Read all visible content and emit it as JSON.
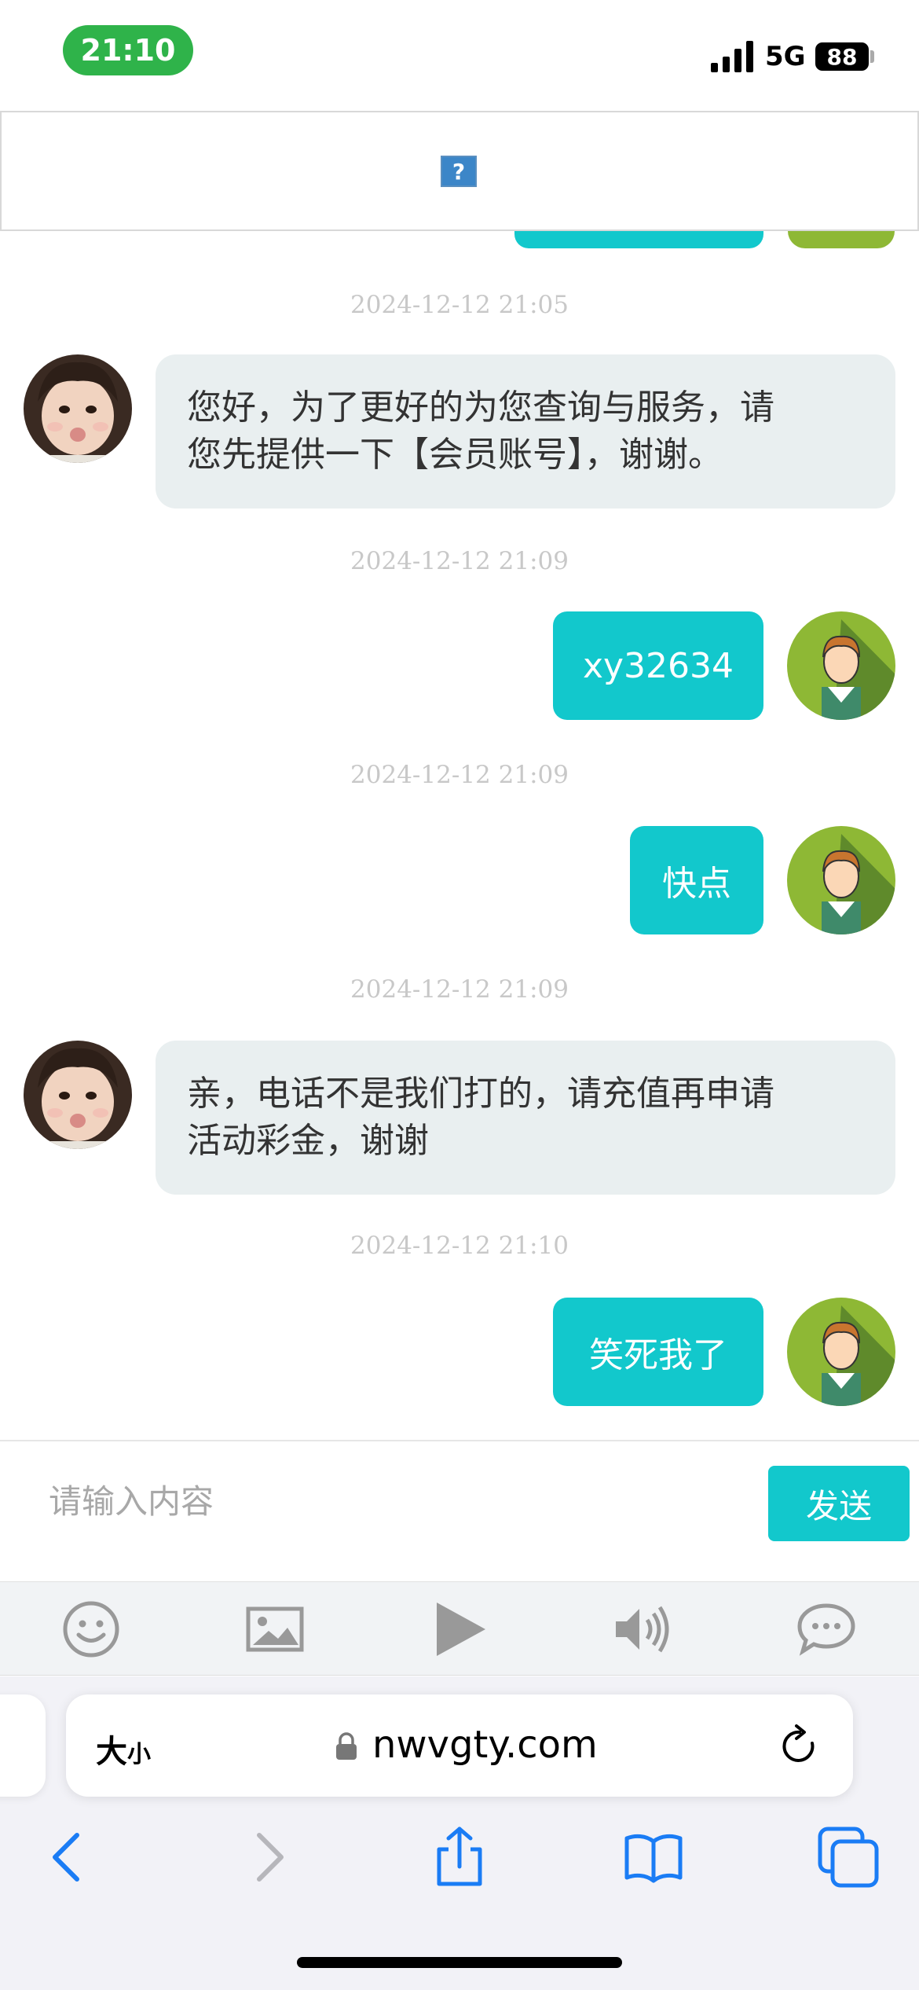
{
  "status_bar": {
    "time": "21:10",
    "network": "5G",
    "battery": "88"
  },
  "messages": [
    {
      "timestamp": "2024-12-12 21:05",
      "from": "agent",
      "text_lines": [
        "您好，为了更好的为您查询与服务，请",
        "您先提供一下【会员账号】，谢谢。"
      ]
    },
    {
      "timestamp": "2024-12-12 21:09",
      "from": "user",
      "text": "xy32634"
    },
    {
      "timestamp": "2024-12-12 21:09",
      "from": "user",
      "text": "快点"
    },
    {
      "timestamp": "2024-12-12 21:09",
      "from": "agent",
      "text_lines": [
        "亲，电话不是我们打的，请充值再申请",
        "活动彩金，谢谢"
      ]
    },
    {
      "timestamp": "2024-12-12 21:10",
      "from": "user",
      "text": "笑死我了"
    }
  ],
  "composer": {
    "placeholder": "请输入内容",
    "send_label": "发送"
  },
  "toolbar_icons": [
    "emoji-icon",
    "image-icon",
    "play-icon",
    "speaker-icon",
    "chat-bubble-icon"
  ],
  "safari": {
    "text_size_label_big": "大",
    "text_size_label_small": "小",
    "url": "nwvgty.com"
  },
  "colors": {
    "accent": "#12c8cc",
    "time_pill": "#2fb34a",
    "agent_bubble": "#e9eff0",
    "ios_blue": "#1a7cf5"
  }
}
